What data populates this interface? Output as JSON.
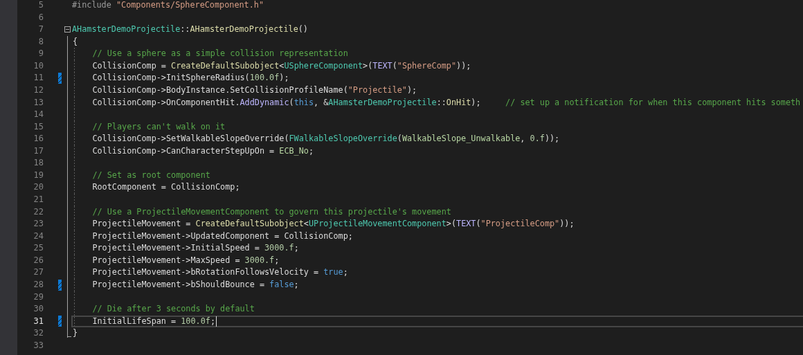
{
  "editor": {
    "lines": [
      {
        "number": "5",
        "changed": false,
        "current": false,
        "tokens": [
          {
            "kind": "preproc",
            "text": "#include "
          },
          {
            "kind": "string",
            "text": "\"Components/SphereComponent.h\""
          }
        ]
      },
      {
        "number": "6",
        "changed": false,
        "current": false
      },
      {
        "number": "7",
        "changed": false,
        "current": false,
        "expanded": true,
        "tokens": [
          {
            "kind": "type",
            "text": "AHamsterDemoProjectile"
          },
          {
            "kind": "plain",
            "text": "::"
          },
          {
            "kind": "func",
            "text": "AHamsterDemoProjectile"
          },
          {
            "kind": "plain",
            "text": "()"
          }
        ],
        "children": [
          {
            "number": "8",
            "changed": false,
            "current": false,
            "tokens": [
              {
                "kind": "plain",
                "text": "{"
              }
            ]
          },
          {
            "number": "9",
            "changed": false,
            "current": false,
            "tokens": [
              {
                "kind": "comment",
                "text": "    // Use a sphere as a simple collision representation"
              }
            ]
          },
          {
            "number": "10",
            "changed": false,
            "current": false,
            "tokens": [
              {
                "kind": "plain",
                "text": "    CollisionComp = "
              },
              {
                "kind": "func",
                "text": "CreateDefaultSubobject"
              },
              {
                "kind": "plain",
                "text": "<"
              },
              {
                "kind": "type",
                "text": "USphereComponent"
              },
              {
                "kind": "plain",
                "text": ">("
              },
              {
                "kind": "macro",
                "text": "TEXT"
              },
              {
                "kind": "plain",
                "text": "("
              },
              {
                "kind": "string",
                "text": "\"SphereComp\""
              },
              {
                "kind": "plain",
                "text": "));"
              }
            ]
          },
          {
            "number": "11",
            "changed": true,
            "current": false,
            "tokens": [
              {
                "kind": "plain",
                "text": "    CollisionComp->InitSphereRadius("
              },
              {
                "kind": "number",
                "text": "100.0f"
              },
              {
                "kind": "plain",
                "text": ");"
              }
            ]
          },
          {
            "number": "12",
            "changed": false,
            "current": false,
            "tokens": [
              {
                "kind": "plain",
                "text": "    CollisionComp->BodyInstance.SetCollisionProfileName("
              },
              {
                "kind": "string",
                "text": "\"Projectile\""
              },
              {
                "kind": "plain",
                "text": ");"
              }
            ]
          },
          {
            "number": "13",
            "changed": false,
            "current": false,
            "tokens": [
              {
                "kind": "plain",
                "text": "    CollisionComp->OnComponentHit."
              },
              {
                "kind": "macro",
                "text": "AddDynamic"
              },
              {
                "kind": "plain",
                "text": "("
              },
              {
                "kind": "keyword",
                "text": "this"
              },
              {
                "kind": "plain",
                "text": ", &"
              },
              {
                "kind": "type",
                "text": "AHamsterDemoProjectile"
              },
              {
                "kind": "plain",
                "text": "::"
              },
              {
                "kind": "func",
                "text": "OnHit"
              },
              {
                "kind": "plain",
                "text": ");     "
              },
              {
                "kind": "comment",
                "text": "// set up a notification for when this component hits someth"
              }
            ]
          },
          {
            "number": "14",
            "changed": false,
            "current": false
          },
          {
            "number": "15",
            "changed": false,
            "current": false,
            "tokens": [
              {
                "kind": "comment",
                "text": "    // Players can't walk on it"
              }
            ]
          },
          {
            "number": "16",
            "changed": false,
            "current": false,
            "tokens": [
              {
                "kind": "plain",
                "text": "    CollisionComp->SetWalkableSlopeOverride("
              },
              {
                "kind": "type",
                "text": "FWalkableSlopeOverride"
              },
              {
                "kind": "plain",
                "text": "("
              },
              {
                "kind": "enum",
                "text": "WalkableSlope_Unwalkable"
              },
              {
                "kind": "plain",
                "text": ", "
              },
              {
                "kind": "number",
                "text": "0.f"
              },
              {
                "kind": "plain",
                "text": "));"
              }
            ]
          },
          {
            "number": "17",
            "changed": false,
            "current": false,
            "tokens": [
              {
                "kind": "plain",
                "text": "    CollisionComp->CanCharacterStepUpOn = "
              },
              {
                "kind": "enum",
                "text": "ECB_No"
              },
              {
                "kind": "plain",
                "text": ";"
              }
            ]
          },
          {
            "number": "18",
            "changed": false,
            "current": false
          },
          {
            "number": "19",
            "changed": false,
            "current": false,
            "tokens": [
              {
                "kind": "comment",
                "text": "    // Set as root component"
              }
            ]
          },
          {
            "number": "20",
            "changed": false,
            "current": false,
            "tokens": [
              {
                "kind": "plain",
                "text": "    RootComponent = CollisionComp;"
              }
            ]
          },
          {
            "number": "21",
            "changed": false,
            "current": false
          },
          {
            "number": "22",
            "changed": false,
            "current": false,
            "tokens": [
              {
                "kind": "comment",
                "text": "    // Use a ProjectileMovementComponent to govern this projectile's movement"
              }
            ]
          },
          {
            "number": "23",
            "changed": false,
            "current": false,
            "tokens": [
              {
                "kind": "plain",
                "text": "    ProjectileMovement = "
              },
              {
                "kind": "func",
                "text": "CreateDefaultSubobject"
              },
              {
                "kind": "plain",
                "text": "<"
              },
              {
                "kind": "type",
                "text": "UProjectileMovementComponent"
              },
              {
                "kind": "plain",
                "text": ">("
              },
              {
                "kind": "macro",
                "text": "TEXT"
              },
              {
                "kind": "plain",
                "text": "("
              },
              {
                "kind": "string",
                "text": "\"ProjectileComp\""
              },
              {
                "kind": "plain",
                "text": "));"
              }
            ]
          },
          {
            "number": "24",
            "changed": false,
            "current": false,
            "tokens": [
              {
                "kind": "plain",
                "text": "    ProjectileMovement->UpdatedComponent = CollisionComp;"
              }
            ]
          },
          {
            "number": "25",
            "changed": false,
            "current": false,
            "tokens": [
              {
                "kind": "plain",
                "text": "    ProjectileMovement->InitialSpeed = "
              },
              {
                "kind": "number",
                "text": "3000.f"
              },
              {
                "kind": "plain",
                "text": ";"
              }
            ]
          },
          {
            "number": "26",
            "changed": false,
            "current": false,
            "tokens": [
              {
                "kind": "plain",
                "text": "    ProjectileMovement->MaxSpeed = "
              },
              {
                "kind": "number",
                "text": "3000.f"
              },
              {
                "kind": "plain",
                "text": ";"
              }
            ]
          },
          {
            "number": "27",
            "changed": false,
            "current": false,
            "tokens": [
              {
                "kind": "plain",
                "text": "    ProjectileMovement->bRotationFollowsVelocity = "
              },
              {
                "kind": "keyword",
                "text": "true"
              },
              {
                "kind": "plain",
                "text": ";"
              }
            ]
          },
          {
            "number": "28",
            "changed": true,
            "current": false,
            "tokens": [
              {
                "kind": "plain",
                "text": "    ProjectileMovement->bShouldBounce = "
              },
              {
                "kind": "keyword",
                "text": "false"
              },
              {
                "kind": "plain",
                "text": ";"
              }
            ]
          },
          {
            "number": "29",
            "changed": false,
            "current": false
          },
          {
            "number": "30",
            "changed": false,
            "current": false,
            "tokens": [
              {
                "kind": "comment",
                "text": "    // Die after 3 seconds by default"
              }
            ]
          },
          {
            "number": "31",
            "changed": true,
            "current": true,
            "tokens": [
              {
                "kind": "plain",
                "text": "    InitialLifeSpan = "
              },
              {
                "kind": "number",
                "text": "100.0f"
              },
              {
                "kind": "plain",
                "text": ";"
              }
            ]
          },
          {
            "number": "32",
            "changed": false,
            "current": false,
            "tokens": [
              {
                "kind": "plain",
                "text": "}"
              }
            ]
          }
        ]
      },
      {
        "number": "33",
        "changed": false,
        "current": false
      }
    ]
  }
}
